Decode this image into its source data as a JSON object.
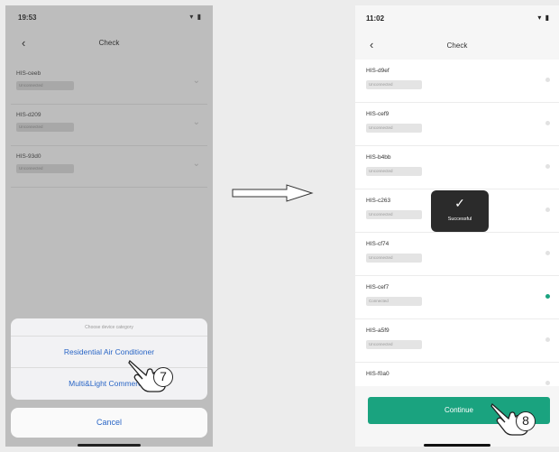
{
  "left_screen": {
    "status": {
      "time": "19:53",
      "icons": "▾ ▮"
    },
    "nav": {
      "back": "‹",
      "title": "Check"
    },
    "devices": [
      {
        "name": "HIS-ceeb",
        "status": "Unconnected"
      },
      {
        "name": "HIS-d209",
        "status": "Unconnected"
      },
      {
        "name": "HIS-93d0",
        "status": "Unconnected"
      }
    ],
    "sheet": {
      "header": "Choose device category",
      "options": [
        "Residential Air Conditioner",
        "Multi&Light Commercial"
      ]
    },
    "cancel_label": "Cancel",
    "step_number": "7"
  },
  "right_screen": {
    "status": {
      "time": "11:02",
      "icons": "▾ ▮"
    },
    "nav": {
      "back": "‹",
      "title": "Check"
    },
    "devices": [
      {
        "name": "HIS-d9ef",
        "status": "Unconnected",
        "selected": false
      },
      {
        "name": "HIS-cef9",
        "status": "Unconnected",
        "selected": false
      },
      {
        "name": "HIS-b4bb",
        "status": "Unconnected",
        "selected": false
      },
      {
        "name": "HIS-c263",
        "status": "Unconnected",
        "selected": false
      },
      {
        "name": "HIS-cf74",
        "status": "Unconnected",
        "selected": false
      },
      {
        "name": "HIS-cef7",
        "status": "Connected",
        "selected": true
      },
      {
        "name": "HIS-a5f9",
        "status": "Unconnected",
        "selected": false
      },
      {
        "name": "HIS-f0a0",
        "status": "",
        "selected": false
      }
    ],
    "toast": {
      "icon": "✓",
      "text": "Successful"
    },
    "continue_label": "Continue",
    "step_number": "8"
  },
  "arrow_icon": "right-arrow-icon",
  "colors": {
    "accent_green": "#1aa37f",
    "link_blue": "#2a66c6"
  }
}
